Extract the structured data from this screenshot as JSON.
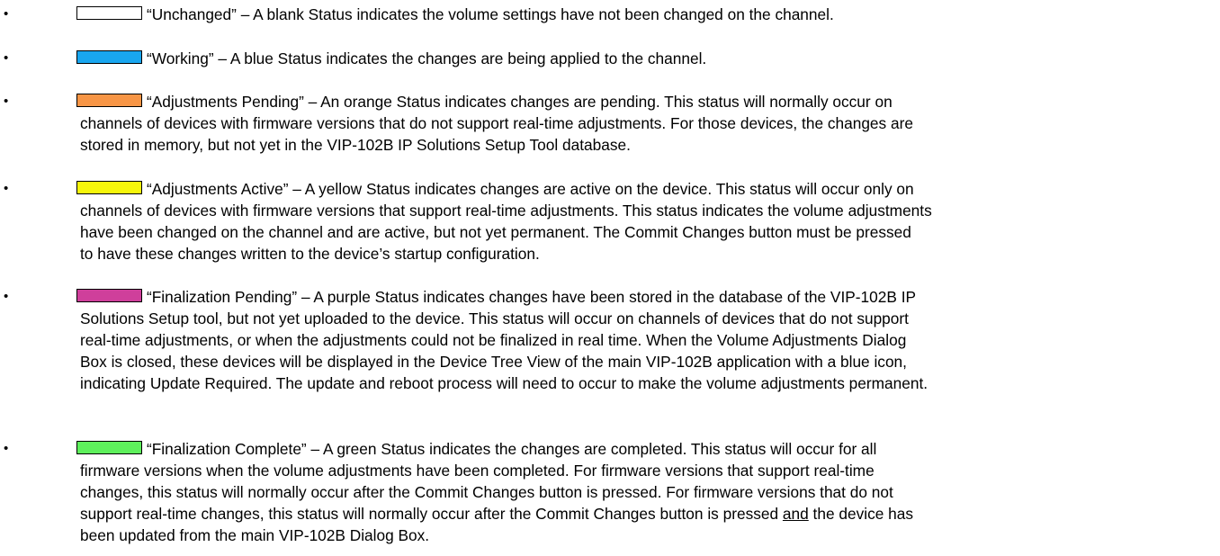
{
  "status_list": {
    "items": [
      {
        "status": "Unchanged",
        "color": "#ffffff",
        "lines": [
          "“Unchanged” – A blank Status indicates the volume settings have not been changed on the channel."
        ]
      },
      {
        "status": "Working",
        "color": "#19a6ef",
        "lines": [
          "“Working” – A blue Status indicates the changes are being applied to the channel."
        ]
      },
      {
        "status": "Adjustments Pending",
        "color": "#f79545",
        "lines": [
          " “Adjustments Pending” – An orange Status indicates changes are pending.  This status will normally occur on",
          "channels of devices with firmware versions that do not support real-time adjustments.  For those devices, the changes are",
          "stored in memory, but not yet in the VIP-102B IP Solutions Setup Tool database."
        ]
      },
      {
        "status": "Adjustments Active",
        "color": "#f6f60b",
        "lines": [
          "“Adjustments Active” – A yellow Status indicates changes are active on the device.  This status will occur only on",
          "channels of devices with firmware versions that support real-time adjustments.  This status indicates the volume adjustments",
          "have been changed on the channel and are active, but not yet permanent.  The Commit Changes button must be pressed",
          "to have these changes written to the device’s startup configuration."
        ]
      },
      {
        "status": "Finalization Pending",
        "color": "#cf3f9b",
        "lines": [
          "“Finalization Pending” – A purple Status indicates changes have been stored in the database of the VIP-102B IP",
          "Solutions Setup tool, but not yet uploaded to the device.  This status will occur on channels of devices that do not support",
          "real-time adjustments, or when the adjustments could not be finalized in real time.  When the Volume Adjustments Dialog",
          "Box is closed, these devices will be displayed in the Device Tree View of the main VIP-102B application with a blue icon,",
          "indicating Update Required.  The update and reboot process will need to occur to make the volume adjustments permanent."
        ]
      },
      {
        "status": "Finalization Complete",
        "color": "#5ef05c",
        "lines": [
          "“Finalization Complete” – A green Status indicates the changes are completed.  This status will occur for all",
          "firmware versions when the volume adjustments have been completed.  For firmware versions that support real-time",
          "changes, this status will normally occur after the Commit Changes button is pressed.  For firmware versions that do not",
          "support real-time changes, this status will normally occur after the Commit Changes button is pressed",
          "and",
          " the device has",
          "been updated from the main VIP-102B Dialog Box."
        ]
      }
    ]
  }
}
